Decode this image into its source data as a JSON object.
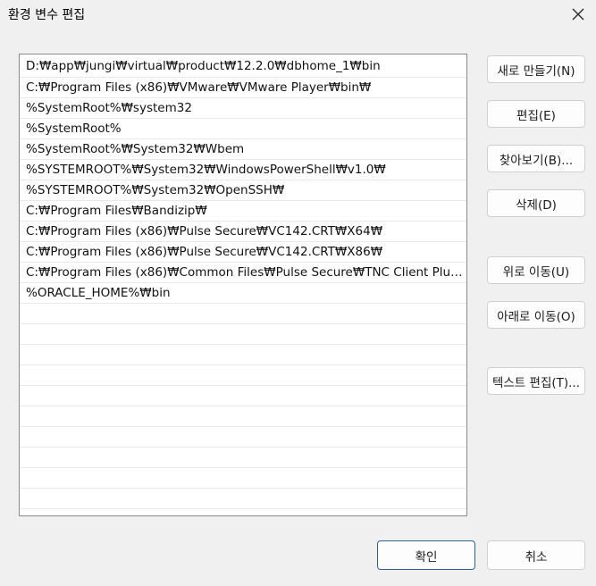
{
  "window": {
    "title": "환경 변수 편집"
  },
  "paths": [
    "D:₩app₩jungi₩virtual₩product₩12.2.0₩dbhome_1₩bin",
    "C:₩Program Files (x86)₩VMware₩VMware Player₩bin₩",
    "%SystemRoot%₩system32",
    "%SystemRoot%",
    "%SystemRoot%₩System32₩Wbem",
    "%SYSTEMROOT%₩System32₩WindowsPowerShell₩v1.0₩",
    "%SYSTEMROOT%₩System32₩OpenSSH₩",
    "C:₩Program Files₩Bandizip₩",
    "C:₩Program Files (x86)₩Pulse Secure₩VC142.CRT₩X64₩",
    "C:₩Program Files (x86)₩Pulse Secure₩VC142.CRT₩X86₩",
    "C:₩Program Files (x86)₩Common Files₩Pulse Secure₩TNC Client Plug...",
    "%ORACLE_HOME%₩bin"
  ],
  "buttons": {
    "new": "새로 만들기(N)",
    "edit": "편집(E)",
    "browse": "찾아보기(B)...",
    "delete": "삭제(D)",
    "move_up": "위로 이동(U)",
    "move_down": "아래로 이동(O)",
    "edit_text": "텍스트 편집(T)...",
    "ok": "확인",
    "cancel": "취소"
  },
  "icons": {
    "close": "close-icon"
  }
}
